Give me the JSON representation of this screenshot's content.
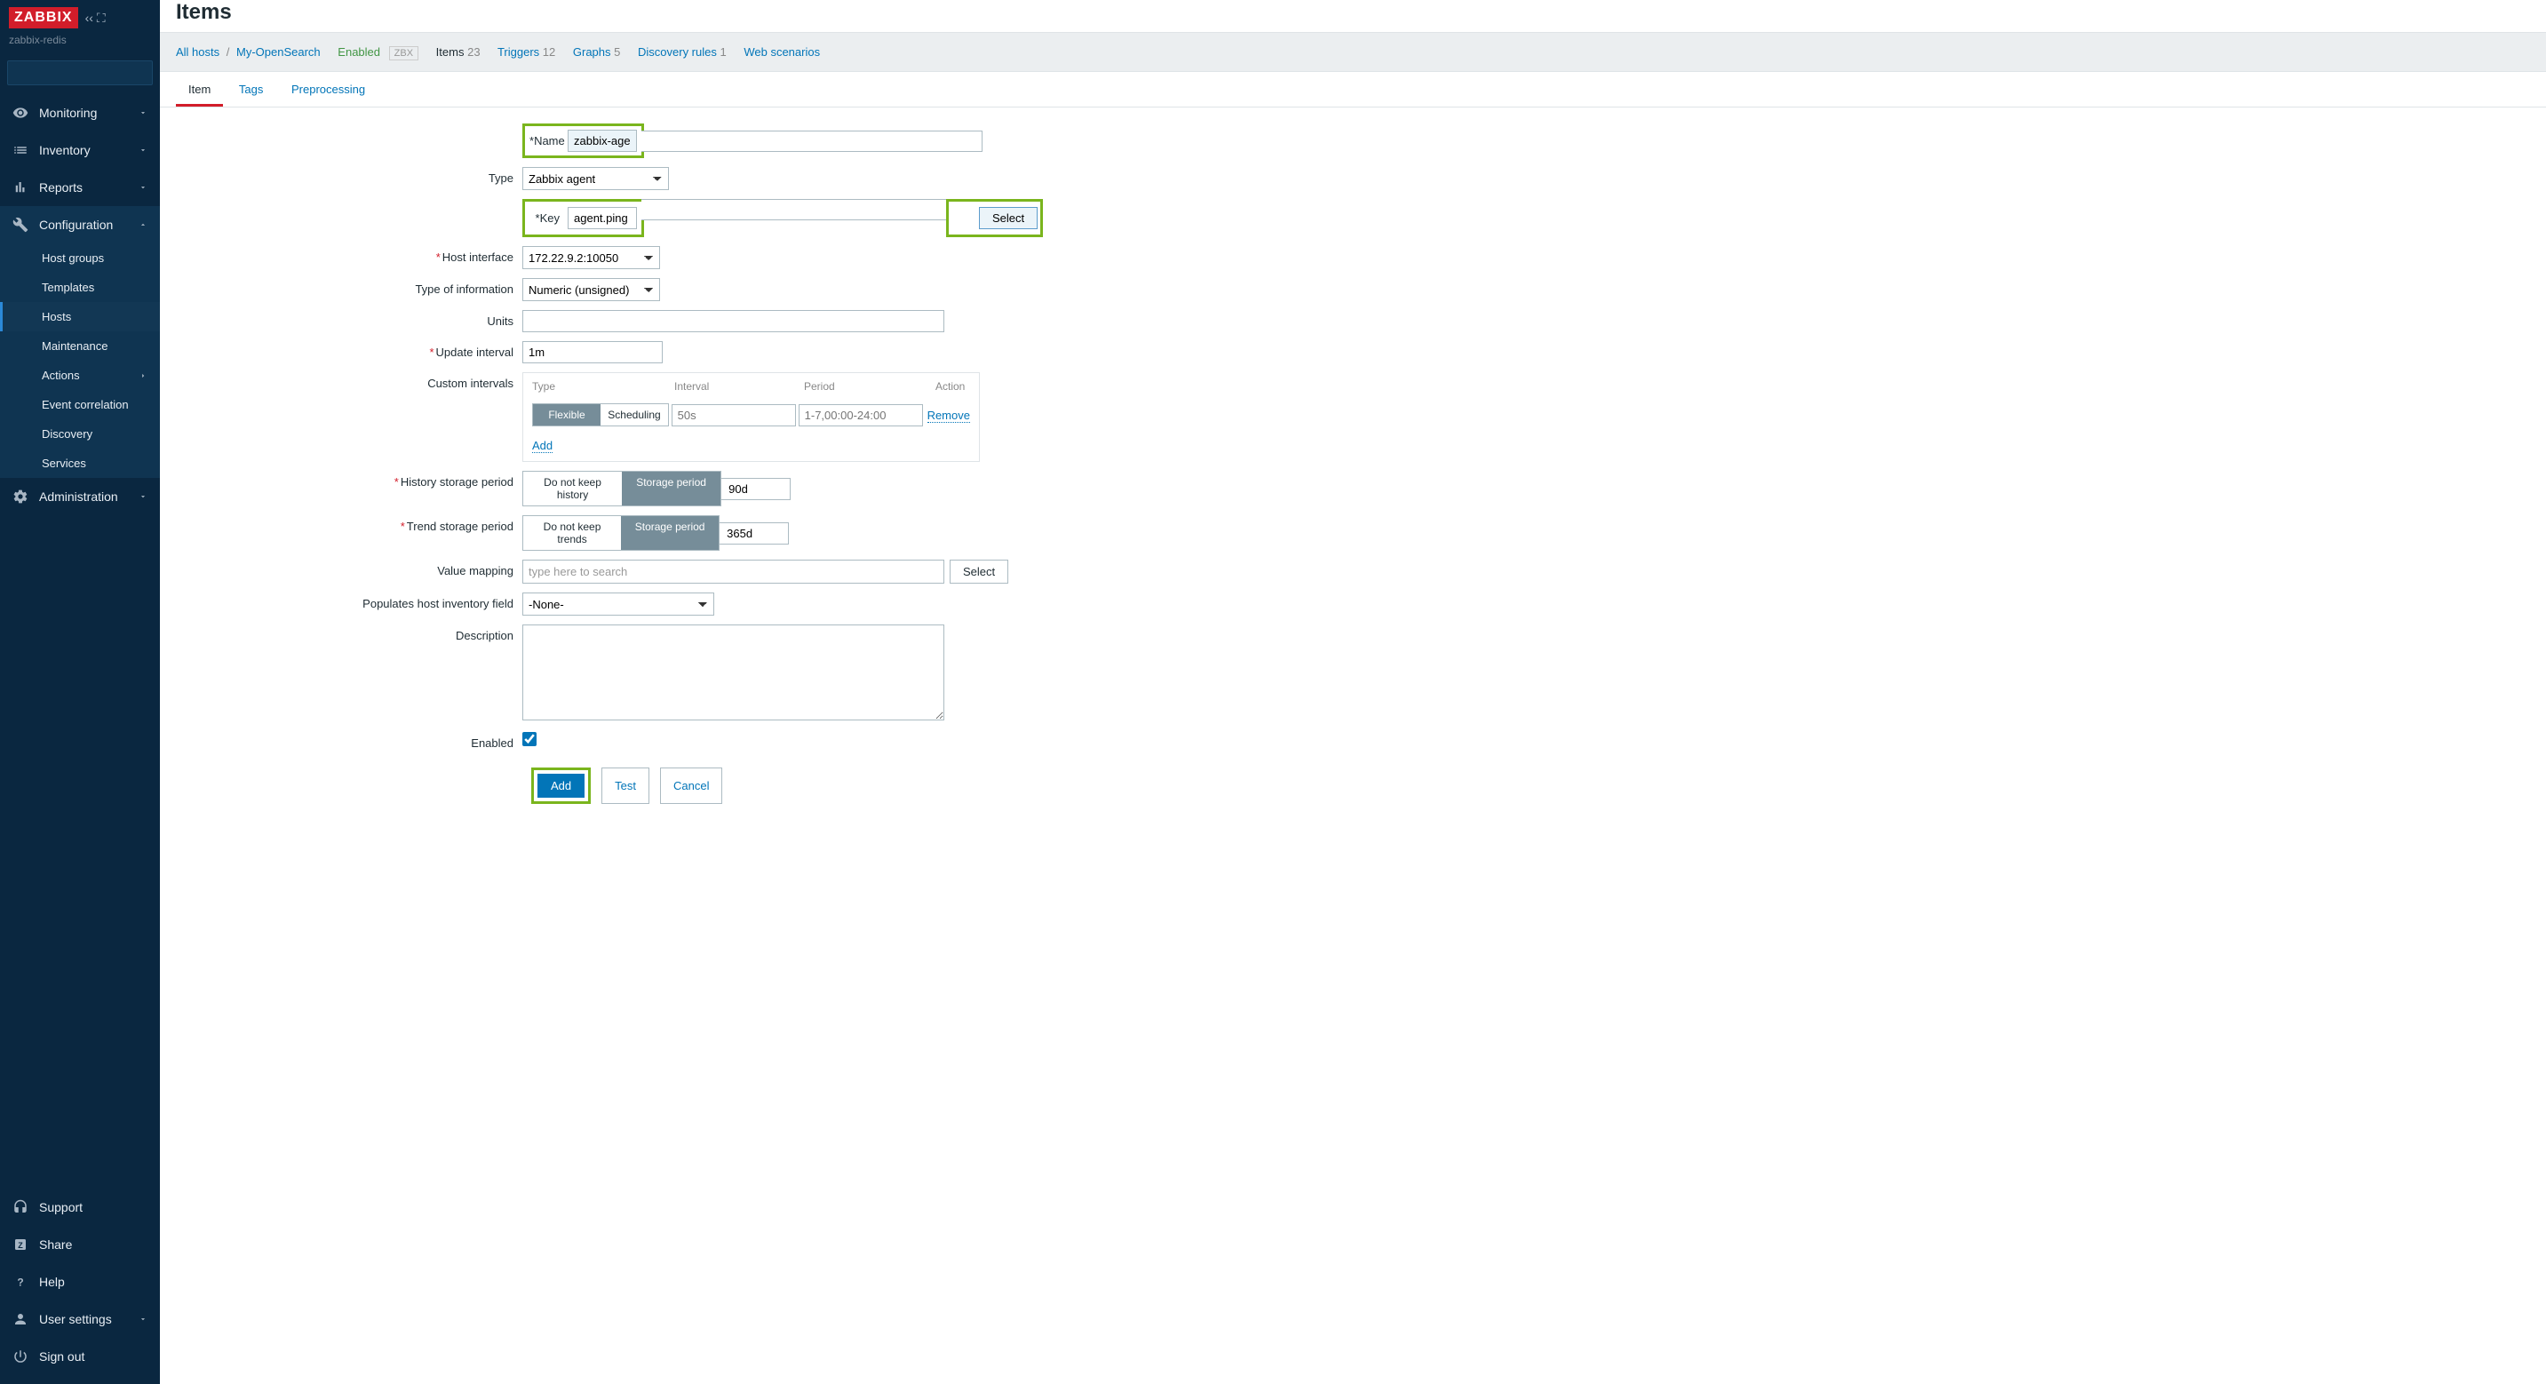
{
  "app": {
    "logo": "ZABBIX",
    "server": "zabbix-redis"
  },
  "sidebar": {
    "monitoring": "Monitoring",
    "inventory": "Inventory",
    "reports": "Reports",
    "configuration": "Configuration",
    "config_items": {
      "host_groups": "Host groups",
      "templates": "Templates",
      "hosts": "Hosts",
      "maintenance": "Maintenance",
      "actions": "Actions",
      "event_correlation": "Event correlation",
      "discovery": "Discovery",
      "services": "Services"
    },
    "administration": "Administration",
    "support": "Support",
    "share": "Share",
    "help": "Help",
    "user_settings": "User settings",
    "sign_out": "Sign out"
  },
  "page": {
    "title": "Items"
  },
  "filter": {
    "all_hosts": "All hosts",
    "host_name": "My-OpenSearch",
    "enabled": "Enabled",
    "zbx": "ZBX",
    "items_label": "Items",
    "items_count": "23",
    "triggers_label": "Triggers",
    "triggers_count": "12",
    "graphs_label": "Graphs",
    "graphs_count": "5",
    "discovery_label": "Discovery rules",
    "discovery_count": "1",
    "web_label": "Web scenarios"
  },
  "tabs": {
    "item": "Item",
    "tags": "Tags",
    "preprocessing": "Preprocessing"
  },
  "form": {
    "name_label": "Name",
    "name_value": "zabbix-agent",
    "type_label": "Type",
    "type_value": "Zabbix agent",
    "key_label": "Key",
    "key_value": "agent.ping",
    "select_btn": "Select",
    "host_if_label": "Host interface",
    "host_if_value": "172.22.9.2:10050",
    "info_type_label": "Type of information",
    "info_type_value": "Numeric (unsigned)",
    "units_label": "Units",
    "units_value": "",
    "update_interval_label": "Update interval",
    "update_interval_value": "1m",
    "custom_intervals_label": "Custom intervals",
    "ci_head_type": "Type",
    "ci_head_interval": "Interval",
    "ci_head_period": "Period",
    "ci_head_action": "Action",
    "ci_flexible": "Flexible",
    "ci_scheduling": "Scheduling",
    "ci_interval_ph": "50s",
    "ci_period_ph": "1-7,00:00-24:00",
    "ci_remove": "Remove",
    "ci_add": "Add",
    "history_label": "History storage period",
    "history_nokeep": "Do not keep history",
    "history_period": "Storage period",
    "history_value": "90d",
    "trend_label": "Trend storage period",
    "trend_nokeep": "Do not keep trends",
    "trend_period": "Storage period",
    "trend_value": "365d",
    "valuemap_label": "Value mapping",
    "valuemap_ph": "type here to search",
    "inventory_label": "Populates host inventory field",
    "inventory_value": "-None-",
    "description_label": "Description",
    "enabled_label": "Enabled",
    "btn_add": "Add",
    "btn_test": "Test",
    "btn_cancel": "Cancel"
  }
}
